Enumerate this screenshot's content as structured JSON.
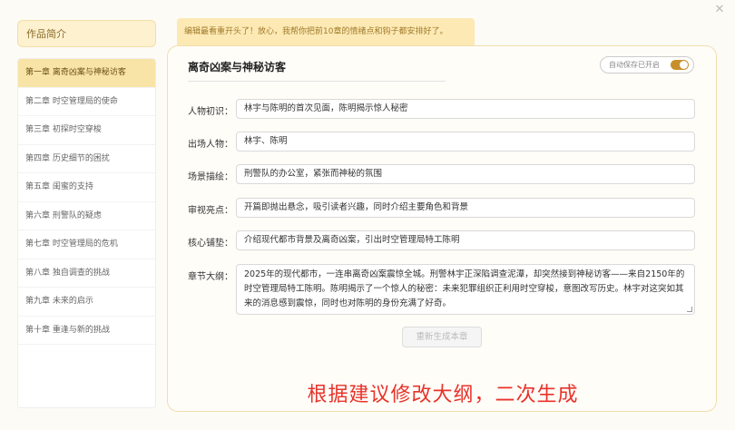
{
  "sidebar": {
    "title": "作品简介",
    "chapters": [
      "第一章 离奇凶案与神秘访客",
      "第二章 时空管理局的使命",
      "第三章 初探时空穿梭",
      "第四章 历史细节的困扰",
      "第五章 闺蜜的支持",
      "第六章 刑警队的疑虑",
      "第七章 时空管理局的危机",
      "第八章 独自调查的挑战",
      "第九章 未来的启示",
      "第十章 重逢与新的挑战"
    ]
  },
  "tip": "编辑最看重开头了！放心，我帮你把前10章的情绪点和钩子都安排好了。",
  "panel": {
    "title": "离奇凶案与神秘访客",
    "autosave_label": "自动保存已开启",
    "autosave_on": true,
    "fields": {
      "characters_intro": {
        "label": "人物初识：",
        "value": "林宇与陈明的首次见面，陈明揭示惊人秘密"
      },
      "appearing": {
        "label": "出场人物：",
        "value": "林宇、陈明"
      },
      "scene": {
        "label": "场景描绘：",
        "value": "刑警队的办公室，紧张而神秘的氛围"
      },
      "highlights": {
        "label": "审视亮点：",
        "value": "开篇即抛出悬念，吸引读者兴趣，同时介绍主要角色和背景"
      },
      "foreshadow": {
        "label": "核心铺垫：",
        "value": "介绍现代都市背景及离奇凶案，引出时空管理局特工陈明"
      },
      "outline": {
        "label": "章节大纲：",
        "value": "2025年的现代都市，一连串离奇凶案震惊全城。刑警林宇正深陷调查泥潭，却突然接到神秘访客——来自2150年的时空管理局特工陈明。陈明揭示了一个惊人的秘密：未来犯罪组织正利用时空穿梭，意图改写历史。林宇对这突如其来的消息感到震惊，同时也对陈明的身份充满了好奇。"
      }
    },
    "regen_button": "重新生成本章"
  },
  "caption": "根据建议修改大纲，二次生成",
  "colors": {
    "accent": "#c8902c",
    "caption": "#e8332a",
    "active_chapter_bg": "#f9e4a8"
  }
}
